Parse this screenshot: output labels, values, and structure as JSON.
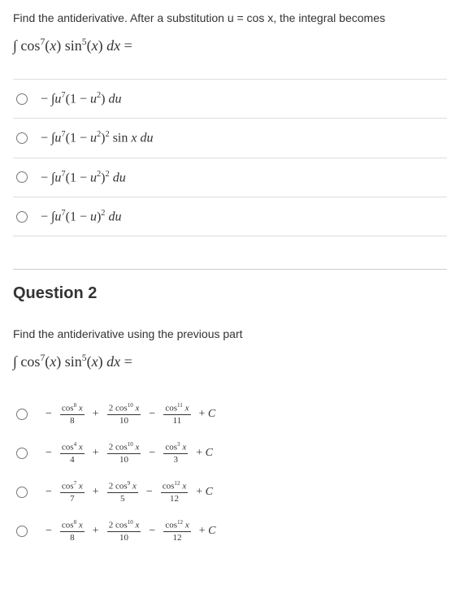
{
  "q1": {
    "prompt": "Find the antiderivative. After a substitution u = cos x, the integral becomes",
    "integral_html": "∫ cos<sup>7</sup>(<span class='ital'>x</span>) sin<sup>5</sup>(<span class='ital'>x</span>) <span class='ital'>dx</span> =",
    "options": [
      "− ∫<span class='ital'>u</span><sup>7</sup>(1 − <span class='ital'>u</span><sup>2</sup>) <span class='ital'>du</span>",
      "− ∫<span class='ital'>u</span><sup>7</sup>(1 − <span class='ital'>u</span><sup>2</sup>)<sup>2</sup> sin <span class='ital'>x du</span>",
      "− ∫<span class='ital'>u</span><sup>7</sup>(1 − <span class='ital'>u</span><sup>2</sup>)<sup>2</sup> <span class='ital'>du</span>",
      "− ∫<span class='ital'>u</span><sup>7</sup>(1 − <span class='ital'>u</span>)<sup>2</sup> <span class='ital'>du</span>"
    ]
  },
  "q2": {
    "title": "Question 2",
    "prompt": "Find the antiderivative using the previous part",
    "integral_html": "∫ cos<sup>7</sup>(<span class='ital'>x</span>) sin<sup>5</sup>(<span class='ital'>x</span>) <span class='ital'>dx</span> =",
    "options": [
      {
        "f1n": "cos<sup>8</sup> <span class='ital'>x</span>",
        "f1d": "8",
        "f2n": "2 cos<sup>10</sup> <span class='ital'>x</span>",
        "f2d": "10",
        "f3n": "cos<sup>11</sup> <span class='ital'>x</span>",
        "f3d": "11"
      },
      {
        "f1n": "cos<sup>4</sup> <span class='ital'>x</span>",
        "f1d": "4",
        "f2n": "2 cos<sup>10</sup> <span class='ital'>x</span>",
        "f2d": "10",
        "f3n": "cos<sup>3</sup> <span class='ital'>x</span>",
        "f3d": "3"
      },
      {
        "f1n": "cos<sup>7</sup> <span class='ital'>x</span>",
        "f1d": "7",
        "f2n": "2 cos<sup>9</sup> <span class='ital'>x</span>",
        "f2d": "5",
        "f3n": "cos<sup>12</sup> <span class='ital'>x</span>",
        "f3d": "12"
      },
      {
        "f1n": "cos<sup>8</sup> <span class='ital'>x</span>",
        "f1d": "8",
        "f2n": "2 cos<sup>10</sup> <span class='ital'>x</span>",
        "f2d": "10",
        "f3n": "cos<sup>12</sup> <span class='ital'>x</span>",
        "f3d": "12"
      }
    ],
    "constant": "+ <span class='ital'>C</span>"
  }
}
